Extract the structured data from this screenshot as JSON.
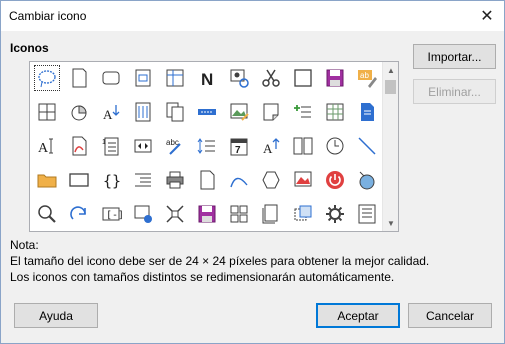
{
  "window": {
    "title": "Cambiar icono",
    "close_glyph": "✕"
  },
  "icons_section": {
    "label": "Iconos"
  },
  "buttons": {
    "import": "Importar...",
    "delete": "Eliminar...",
    "help": "Ayuda",
    "accept": "Aceptar",
    "cancel": "Cancelar"
  },
  "note": {
    "heading": "Nota:",
    "line1": "El tamaño del icono debe ser de 24 × 24 píxeles para obtener la mejor calidad.",
    "line2": "Los iconos con tamaños distintos se redimensionarán automáticamente."
  },
  "icon_grid": {
    "selected_index": 0,
    "icons": [
      "lasso-icon",
      "page-icon",
      "rounded-rect-icon",
      "form-page-icon",
      "table-frame-icon",
      "bold-n-icon",
      "image-settings-icon",
      "scissors-icon",
      "square-icon",
      "save-purple-icon",
      "edit-text-icon",
      "grid-cross-icon",
      "pie-slice-icon",
      "font-down-icon",
      "page-columns-icon",
      "copy-page-icon",
      "blue-bar-icon",
      "image-edit-icon",
      "note-icon",
      "add-list-icon",
      "spreadsheet-icon",
      "blue-doc-icon",
      "text-cursor-icon",
      "pdf-icon",
      "numbered-page-icon",
      "arrows-lr-icon",
      "spellcheck-icon",
      "line-spacing-icon",
      "calendar-7-icon",
      "font-up-icon",
      "two-pages-icon",
      "clock-icon",
      "diagonal-line-icon",
      "folder-icon",
      "rectangle-icon",
      "braces-icon",
      "list-indent-icon",
      "printer-icon",
      "blank-page-icon",
      "curve-icon",
      "hexagon-icon",
      "image-frame-icon",
      "power-icon",
      "circle-tool-icon",
      "zoom-icon",
      "redo-arrow-icon",
      "field-bracket-icon",
      "image-gear-icon",
      "cut-corners-icon",
      "save-purple-icon",
      "layout-grid-icon",
      "page-copy-icon",
      "duplicate-icon",
      "gear-icon",
      "table-list-icon"
    ]
  },
  "colors": {
    "accent": "#0078d7",
    "folder": "#f0b048",
    "purple": "#a030a0",
    "blue": "#2e6fd0",
    "red": "#e04040"
  }
}
